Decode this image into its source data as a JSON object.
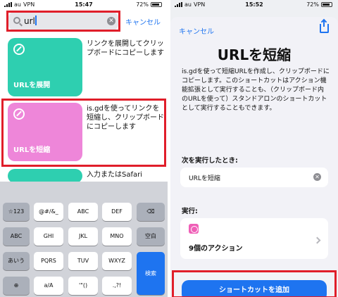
{
  "left": {
    "status": {
      "carrier": "au",
      "network": "VPN",
      "time": "15:47",
      "battery": "72%"
    },
    "search": {
      "value": "url",
      "cancel_label": "キャンセル"
    },
    "results": [
      {
        "title": "URLを展開",
        "description": "リンクを展開してクリップボードにコピーします",
        "color": "#2ecfb0"
      },
      {
        "title": "URLを短縮",
        "description": "is.gdを使ってリンクを短縮し、クリップボードにコピーします",
        "color": "#ee86d9"
      },
      {
        "title": "",
        "description": "入力またはSafari",
        "color": "#2ecfb0"
      }
    ],
    "keyboard": {
      "row1": [
        "☆123",
        "@#/&_",
        "ABC",
        "DEF",
        "⌫"
      ],
      "row2": [
        "ABC",
        "GHI",
        "JKL",
        "MNO",
        "空白"
      ],
      "row3": [
        "あいう",
        "PQRS",
        "TUV",
        "WXYZ",
        "検索"
      ],
      "row4": [
        "globe-icon",
        "a/A",
        "'\"()",
        ".,?!"
      ]
    }
  },
  "right": {
    "status": {
      "carrier": "au",
      "network": "VPN",
      "time": "15:52",
      "battery": "72%"
    },
    "cancel_label": "キャンセル",
    "title": "URLを短縮",
    "description": "is.gdを使って短縮URLを作成し、クリップボードにコピーします。このショートカットはアクション機能拡張として実行することも、（クリップボード内のURLを使って）スタンドアロンのショートカットとして実行することもできます。",
    "when_run_label": "次を実行したとき:",
    "when_run_value": "URLを短縮",
    "run_label": "実行:",
    "action_count": "9個のアクション",
    "add_button": "ショートカットを追加"
  }
}
